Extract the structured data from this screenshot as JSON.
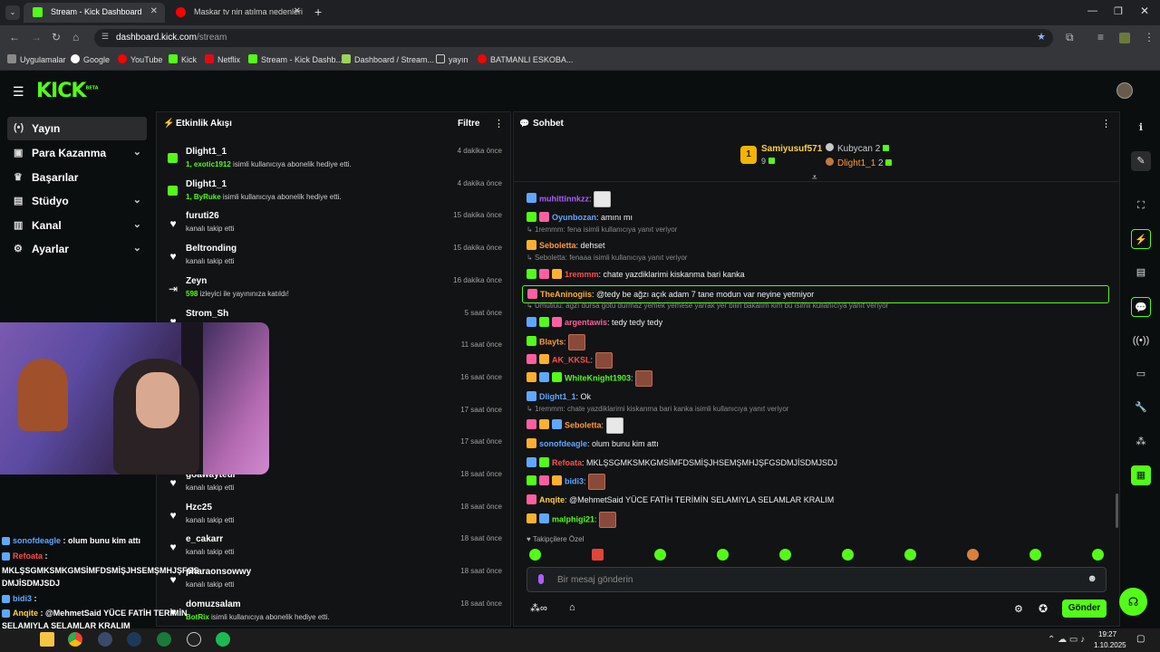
{
  "browser": {
    "tabs": [
      {
        "title": "Stream - Kick Dashboard",
        "active": true
      },
      {
        "title": "Maskar tv nin atılma nedenleri",
        "active": false
      }
    ],
    "url_host": "dashboard.kick.com",
    "url_path": "/stream",
    "bookmarks": [
      "Uygulamalar",
      "Google",
      "YouTube",
      "Kick",
      "Netflix",
      "Stream - Kick Dashb...",
      "Dashboard / Stream...",
      "yayın",
      "BATMANLI ESKOBA..."
    ]
  },
  "kick": {
    "logo": "KICK",
    "logo_badge": "BETA",
    "sidebar": [
      {
        "label": "Yayın",
        "icon": "broadcast-icon",
        "active": true
      },
      {
        "label": "Para Kazanma",
        "icon": "money-icon",
        "chevron": true
      },
      {
        "label": "Başarılar",
        "icon": "trophy-icon"
      },
      {
        "label": "Stüdyo",
        "icon": "studio-icon",
        "chevron": true
      },
      {
        "label": "Kanal",
        "icon": "channel-icon",
        "chevron": true
      },
      {
        "label": "Ayarlar",
        "icon": "gear-icon",
        "chevron": true
      }
    ]
  },
  "activity": {
    "title": "Etkinlik Akışı",
    "filter": "Filtre",
    "items": [
      {
        "name": "Dlight1_1",
        "prefix": "1, exotic1912",
        "text": " isimli kullanıcıya abonelik hediye etti.",
        "time": "4 dakika önce",
        "kind": "gift"
      },
      {
        "name": "Dlight1_1",
        "prefix": "1, ByRuke",
        "text": " isimli kullanıcıya abonelik hediye etti.",
        "time": "4 dakika önce",
        "kind": "gift"
      },
      {
        "name": "furuti26",
        "prefix": "",
        "text": "kanalı takip etti",
        "time": "15 dakika önce",
        "kind": "follow"
      },
      {
        "name": "Beltronding",
        "prefix": "",
        "text": "kanalı takip etti",
        "time": "15 dakika önce",
        "kind": "follow"
      },
      {
        "name": "Zeyn",
        "prefix": "598",
        "text": " izleyici ile yayınınıza katıldı!",
        "time": "16 dakika önce",
        "kind": "raid"
      },
      {
        "name": "Strom_Sh",
        "prefix": "",
        "text": "",
        "time": "5 saat önce",
        "kind": "follow"
      },
      {
        "name": "",
        "prefix": "",
        "text": "",
        "time": "11 saat önce",
        "kind": "none"
      },
      {
        "name": "",
        "prefix": "",
        "text": "",
        "time": "16 saat önce",
        "kind": "none"
      },
      {
        "name": "",
        "prefix": "",
        "text": "ıcıya abonelik hediye etti.",
        "time": "17 saat önce",
        "kind": "none"
      },
      {
        "name": "",
        "prefix": "",
        "text": "",
        "time": "17 saat önce",
        "kind": "none"
      },
      {
        "name": "goawayteur",
        "prefix": "",
        "text": "kanalı takip etti",
        "time": "18 saat önce",
        "kind": "follow"
      },
      {
        "name": "Hzc25",
        "prefix": "",
        "text": "kanalı takip etti",
        "time": "18 saat önce",
        "kind": "follow"
      },
      {
        "name": "e_cakarr",
        "prefix": "",
        "text": "kanalı takip etti",
        "time": "18 saat önce",
        "kind": "follow"
      },
      {
        "name": "pharaonsowwy",
        "prefix": "",
        "text": "kanalı takip etti",
        "time": "18 saat önce",
        "kind": "follow"
      },
      {
        "name": "domuzsalam",
        "prefix": "BotRix",
        "text": " isimli kullanıcıya abonelik hediye etti.",
        "time": "18 saat önce",
        "kind": "follow"
      }
    ]
  },
  "chat": {
    "title": "Sohbet",
    "top_gifters": [
      {
        "name": "Samiyusuf571",
        "count": "9",
        "rank": "1"
      },
      {
        "name": "Kubycan",
        "count": "2"
      },
      {
        "name": "Dlight1_1",
        "count": "2"
      }
    ],
    "followers_only": "Takipçilere Özel",
    "input_placeholder": "Bir mesaj gönderin",
    "send": "Gönder",
    "messages": [
      {
        "user": "muhittinnkzz",
        "color": "#b05cff",
        "text": "",
        "emote": "w"
      },
      {
        "user": "Oyunbozan",
        "color": "#5fa8ff",
        "text": " amını mı"
      },
      {
        "reply": "1remmm: fena isimli kullanıcıya yanıt veriyor"
      },
      {
        "user": "Seboletta",
        "color": "#ff9a3c",
        "text": " dehset"
      },
      {
        "reply": "Seboletta: fenaaa isimli kullanıcıya yanıt veriyor"
      },
      {
        "user": "1remmm",
        "color": "#ff4d4d",
        "text": " chate yazdiklarimi kiskanma bari kanka"
      },
      {
        "user": "TheAninogiis",
        "color": "#ffb02e",
        "text": " @tedy be ağzı açık adam 7 tane modun var neyine yetmiyor",
        "highlight": true
      },
      {
        "reply": "Umutiuu: ağzı dursa götü durmaz yemek yemese yarrak yer bilin bakalım kim bu isimli kullanıcıya yanıt veriyor"
      },
      {
        "user": "argentawis",
        "color": "#ff5fa0",
        "text": " tedy tedy tedy"
      },
      {
        "user": "Blayts",
        "color": "#ff9a3c",
        "text": "",
        "emote": "r"
      },
      {
        "user": "AK_KKSL",
        "color": "#ff4d4d",
        "text": "",
        "emote": "r"
      },
      {
        "user": "WhiteKnight1903",
        "color": "#53fc18",
        "text": "",
        "emote": "r"
      },
      {
        "user": "Dlight1_1",
        "color": "#5fa8ff",
        "text": " Ok"
      },
      {
        "reply": "1remmm: chate yazdiklarimi kiskanma bari kanka isimli kullanıcıya yanıt veriyor"
      },
      {
        "user": "Seboletta",
        "color": "#ff9a3c",
        "text": "",
        "emote": "w"
      },
      {
        "user": "sonofdeagle",
        "color": "#5fa8ff",
        "text": " olum bunu kim attı"
      },
      {
        "user": "Refoata",
        "color": "#ff4d4d",
        "text": " MKLŞSGMKSMKGMSİMFDSMİŞJHSEMŞMHJŞFGSDMJİSDMJSDJ"
      },
      {
        "user": "bidi3",
        "color": "#5fa8ff",
        "text": "",
        "emote": "r"
      },
      {
        "user": "Anqite",
        "color": "#ffd23c",
        "text": " @MehmetSaid YÜCE FATİH TERİMİN SELAMIYLA SELAMLAR KRALIM"
      },
      {
        "user": "malphigi21",
        "color": "#53fc18",
        "text": "",
        "emote": "r"
      }
    ]
  },
  "overlay": {
    "lines": [
      {
        "user": "sonofdeagle",
        "text": " : olum bunu kim attı"
      },
      {
        "user": "Refoata",
        "text": " :"
      },
      {
        "user": "",
        "text": "MKLŞSGMKSMKGMSİMFDSMİŞJHSEMŞMHJŞFGS"
      },
      {
        "user": "",
        "text": "DMJİSDMJSDJ"
      },
      {
        "user": "bidi3",
        "text": " :"
      },
      {
        "user": "Anqite",
        "text": " : @MehmetSaid YÜCE FATİH TERİMİN"
      },
      {
        "user": "",
        "text": "SELAMIYLA SELAMLAR KRALIM"
      },
      {
        "user": "malphigi21",
        "text": " :"
      }
    ]
  },
  "taskbar": {
    "time": "19:27",
    "date": "1.10.2025"
  },
  "colors": {
    "accent": "#53fc18",
    "bg": "#0b0e0f",
    "panel": "#111314"
  }
}
